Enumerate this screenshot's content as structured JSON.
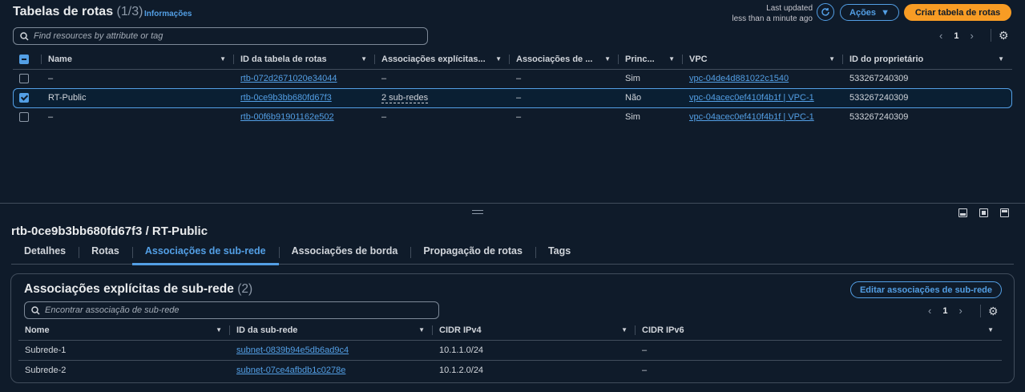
{
  "top": {
    "title": "Tabelas de rotas",
    "count": "(1/3)",
    "info": "Informações",
    "last_updated_1": "Last updated",
    "last_updated_2": "less than a minute ago",
    "actions": "Ações",
    "create": "Criar tabela de rotas",
    "search_placeholder": "Find resources by attribute or tag",
    "page": "1",
    "columns": [
      "Name",
      "ID da tabela de rotas",
      "Associações explícitas...",
      "Associações de ...",
      "Princ...",
      "VPC",
      "ID do proprietário"
    ],
    "rows": [
      {
        "name": "–",
        "id": "rtb-072d2671020e34044",
        "assoc": "–",
        "edge": "–",
        "main": "Sim",
        "vpc": "vpc-04de4d881022c1540",
        "owner": "533267240309"
      },
      {
        "name": "RT-Public",
        "id": "rtb-0ce9b3bb680fd67f3",
        "assoc": "2 sub-redes",
        "edge": "–",
        "main": "Não",
        "vpc": "vpc-04acec0ef410f4b1f | VPC-1",
        "owner": "533267240309"
      },
      {
        "name": "–",
        "id": "rtb-00f6b91901162e502",
        "assoc": "–",
        "edge": "–",
        "main": "Sim",
        "vpc": "vpc-04acec0ef410f4b1f | VPC-1",
        "owner": "533267240309"
      }
    ]
  },
  "detail": {
    "title": "rtb-0ce9b3bb680fd67f3 / RT-Public",
    "tabs": [
      "Detalhes",
      "Rotas",
      "Associações de sub-rede",
      "Associações de borda",
      "Propagação de rotas",
      "Tags"
    ],
    "active_tab": "Associações de sub-rede"
  },
  "subnets": {
    "title": "Associações explícitas de sub-rede",
    "count": "(2)",
    "edit": "Editar associações de sub-rede",
    "search_placeholder": "Encontrar associação de sub-rede",
    "page": "1",
    "columns": [
      "Nome",
      "ID da sub-rede",
      "CIDR IPv4",
      "CIDR IPv6"
    ],
    "rows": [
      {
        "name": "Subrede-1",
        "id": "subnet-0839b94e5db6ad9c4",
        "ipv4": "10.1.1.0/24",
        "ipv6": "–"
      },
      {
        "name": "Subrede-2",
        "id": "subnet-07ce4afbdb1c0278e",
        "ipv4": "10.1.2.0/24",
        "ipv6": "–"
      }
    ]
  },
  "colors": {
    "accent": "#539fe5",
    "primary_button": "#f89c24",
    "background": "#0f1b2a"
  }
}
